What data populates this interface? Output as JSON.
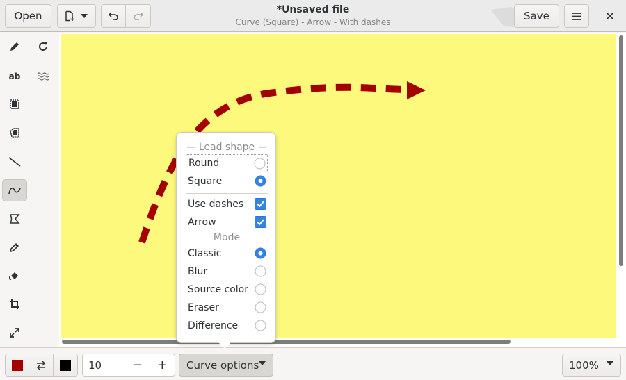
{
  "header": {
    "open_label": "Open",
    "title": "*Unsaved file",
    "subtitle": "Curve (Square)  - Arrow - With dashes",
    "save_label": "Save"
  },
  "sidebar": {
    "tools": [
      {
        "name": "pencil",
        "icon": "pencil-icon"
      },
      {
        "name": "rotate",
        "icon": "rotate-icon"
      },
      {
        "name": "text",
        "icon": "text-icon"
      },
      {
        "name": "blur",
        "icon": "wavy-lines-icon"
      },
      {
        "name": "rectangle-selection",
        "icon": "rect-select-icon"
      },
      {
        "name": "free-selection",
        "icon": "free-select-icon"
      },
      {
        "name": "line",
        "icon": "line-icon"
      },
      {
        "name": "curve",
        "icon": "curve-icon",
        "active": true
      },
      {
        "name": "free-shape",
        "icon": "shape-icon"
      },
      {
        "name": "color-picker",
        "icon": "eyedropper-icon"
      },
      {
        "name": "paint",
        "icon": "paint-bucket-icon"
      },
      {
        "name": "crop",
        "icon": "crop-icon"
      },
      {
        "name": "scale",
        "icon": "scale-icon"
      }
    ],
    "text_tool_label": "ab"
  },
  "canvas": {
    "background": "#fcf97c",
    "stroke_color": "#a50000"
  },
  "popover": {
    "lead_shape_label": "Lead shape",
    "lead_options": [
      {
        "label": "Round",
        "selected": false
      },
      {
        "label": "Square",
        "selected": true
      }
    ],
    "toggles": [
      {
        "label": "Use dashes",
        "checked": true
      },
      {
        "label": "Arrow",
        "checked": true
      }
    ],
    "mode_label": "Mode",
    "mode_options": [
      {
        "label": "Classic",
        "selected": true
      },
      {
        "label": "Blur",
        "selected": false
      },
      {
        "label": "Source color",
        "selected": false
      },
      {
        "label": "Eraser",
        "selected": false
      },
      {
        "label": "Difference",
        "selected": false
      }
    ]
  },
  "bottombar": {
    "main_color": "#a50000",
    "secondary_color": "#000000",
    "size_value": "10",
    "minus_label": "−",
    "plus_label": "+",
    "options_label": "Curve options",
    "zoom_label": "100%"
  },
  "colors": {
    "accent": "#3584e4",
    "header_bg": "#ebebeb"
  }
}
